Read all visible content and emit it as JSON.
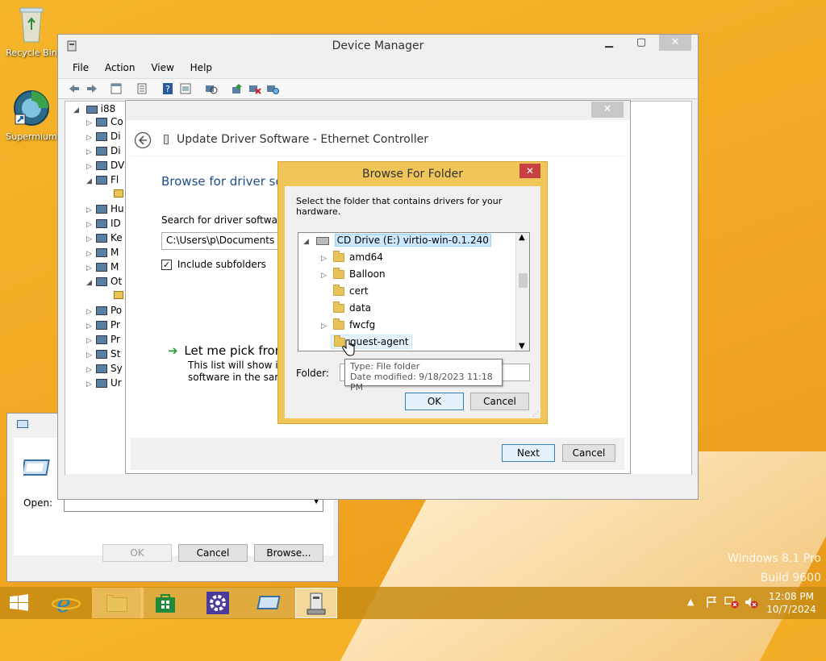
{
  "desktop": {
    "recycle_bin": "Recycle Bin",
    "supermium": "Supermium",
    "watermark_line1": "Windows 8.1 Pro",
    "watermark_line2": "Build 9600"
  },
  "device_manager": {
    "title": "Device Manager",
    "menu": [
      "File",
      "Action",
      "View",
      "Help"
    ],
    "root": "i88",
    "tree_items": [
      "Co",
      "Di",
      "Di",
      "DV",
      "Fl",
      "Hu",
      "ID",
      "Ke",
      "M",
      "M",
      "Ot",
      "Po",
      "Pr",
      "Pr",
      "St",
      "Sy",
      "Ur"
    ]
  },
  "update_driver": {
    "title": "Update Driver Software - Ethernet Controller",
    "heading": "Browse for driver sof",
    "search_label": "Search for driver software in",
    "path_value": "C:\\Users\\p\\Documents",
    "include_subfolders": "Include subfolders",
    "pick_link": "Let me pick from",
    "pick_desc1": "This list will show inst",
    "pick_desc2": "software in the same",
    "next": "Next",
    "cancel": "Cancel"
  },
  "browse_folder": {
    "title": "Browse For Folder",
    "instruction": "Select the folder that contains drivers for your hardware.",
    "drive": "CD Drive (E:) virtio-win-0.1.240",
    "folders": [
      "amd64",
      "Balloon",
      "cert",
      "data",
      "fwcfg",
      "guest-agent"
    ],
    "folder_label": "Folder:",
    "ok": "OK",
    "cancel": "Cancel",
    "tooltip_type": "Type: File folder",
    "tooltip_date": "Date modified: 9/18/2023 11:18 PM"
  },
  "run_dialog": {
    "open_label": "Open:",
    "ok": "OK",
    "cancel": "Cancel",
    "browse": "Browse..."
  },
  "taskbar": {
    "time": "12:08 PM",
    "date": "10/7/2024",
    "accent": "#c88c14"
  }
}
